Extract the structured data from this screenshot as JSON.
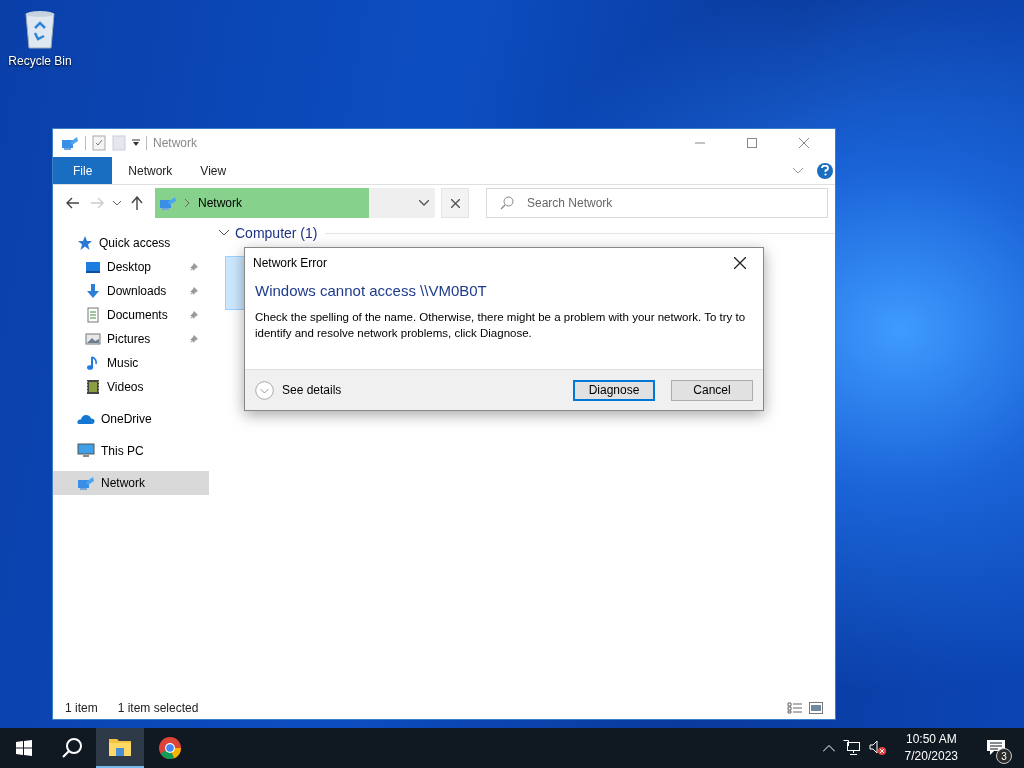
{
  "desktop": {
    "icons": [
      {
        "label": "Recycle Bin"
      }
    ]
  },
  "explorer": {
    "title": "Network",
    "ribbon_tabs": [
      {
        "label": "File",
        "kind": "file"
      },
      {
        "label": "Network",
        "kind": "tab"
      },
      {
        "label": "View",
        "kind": "tab"
      }
    ],
    "address": {
      "path": [
        "Network"
      ]
    },
    "search": {
      "placeholder": "Search Network"
    },
    "nav": [
      {
        "label": "Quick access",
        "selected": false,
        "children": [
          {
            "label": "Desktop",
            "pinned": true,
            "selected": false
          },
          {
            "label": "Downloads",
            "pinned": true,
            "selected": false
          },
          {
            "label": "Documents",
            "pinned": true,
            "selected": false
          },
          {
            "label": "Pictures",
            "pinned": true,
            "selected": false
          },
          {
            "label": "Music",
            "pinned": false,
            "selected": false
          },
          {
            "label": "Videos",
            "pinned": false,
            "selected": false
          }
        ]
      },
      {
        "label": "OneDrive",
        "selected": false
      },
      {
        "label": "This PC",
        "selected": false
      },
      {
        "label": "Network",
        "selected": true
      }
    ],
    "content": {
      "groups": [
        {
          "label": "Computer (1)",
          "expanded": true
        }
      ]
    },
    "status_bar": {
      "count": "1 item",
      "selection": "1 item selected"
    }
  },
  "dialog": {
    "title": "Network Error",
    "heading": "Windows cannot access \\\\VM0B0T",
    "message": "Check the spelling of the name. Otherwise, there might be a problem with your network. To try to identify and resolve network problems, click Diagnose.",
    "details": "See details",
    "buttons": [
      {
        "label": "Diagnose",
        "default": true
      },
      {
        "label": "Cancel",
        "default": false
      }
    ]
  },
  "taskbar": {
    "apps": [
      {
        "active": false
      },
      {
        "active": false
      },
      {
        "active": true
      },
      {
        "active": false
      }
    ],
    "clock": {
      "time": "10:50 AM",
      "date": "7/20/2023"
    },
    "notifications": {
      "count": "3"
    }
  }
}
